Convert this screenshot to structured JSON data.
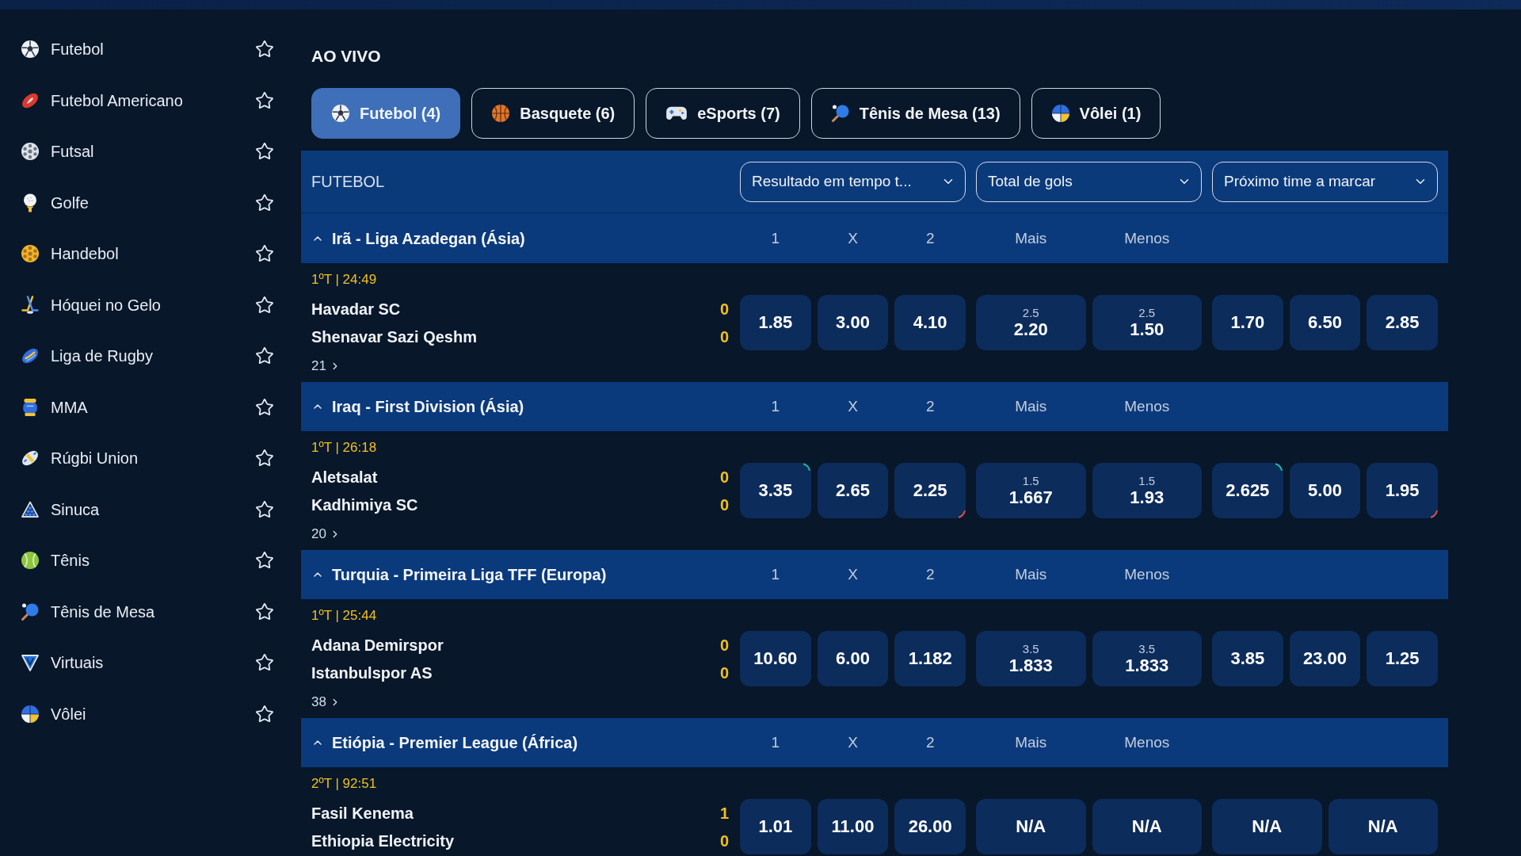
{
  "header": {
    "title": "AO VIVO"
  },
  "sidebar": {
    "items": [
      {
        "label": "Futebol",
        "favorite": false
      },
      {
        "label": "Futebol Americano",
        "favorite": false
      },
      {
        "label": "Futsal",
        "favorite": false
      },
      {
        "label": "Golfe",
        "favorite": false
      },
      {
        "label": "Handebol",
        "favorite": false
      },
      {
        "label": "Hóquei no Gelo",
        "favorite": false
      },
      {
        "label": "Liga de Rugby",
        "favorite": false
      },
      {
        "label": "MMA",
        "favorite": false
      },
      {
        "label": "Rúgbi Union",
        "favorite": false
      },
      {
        "label": "Sinuca",
        "favorite": false
      },
      {
        "label": "Tênis",
        "favorite": false
      },
      {
        "label": "Tênis de Mesa",
        "favorite": false
      },
      {
        "label": "Virtuais",
        "favorite": false
      },
      {
        "label": "Vôlei",
        "favorite": false
      }
    ]
  },
  "tabs": [
    {
      "label": "Futebol (4)",
      "selected": true
    },
    {
      "label": "Basquete (6)",
      "selected": false
    },
    {
      "label": "eSports (7)",
      "selected": false
    },
    {
      "label": "Tênis de Mesa (13)",
      "selected": false
    },
    {
      "label": "Vôlei (1)",
      "selected": false
    }
  ],
  "panel": {
    "sport": "FUTEBOL",
    "dropdowns": [
      "Resultado em tempo t...",
      "Total de gols",
      "Próximo time a marcar"
    ]
  },
  "leagues": [
    {
      "name": "Irã - Liga Azadegan (Ásia)",
      "expanded": true,
      "columns": [
        [
          "1",
          "X",
          "2"
        ],
        [
          "Mais",
          "Menos"
        ]
      ],
      "matches": [
        {
          "time": "1ºT | 24:49",
          "teams": [
            {
              "name": "Havadar SC",
              "score": "0"
            },
            {
              "name": "Shenavar Sazi Qeshm",
              "score": "0"
            }
          ],
          "more": "21",
          "odds": [
            [
              {
                "value": "1.85",
                "rising": false,
                "falling": false
              },
              {
                "value": "3.00",
                "rising": false,
                "falling": false
              },
              {
                "value": "4.10",
                "rising": false,
                "falling": false
              }
            ],
            [
              {
                "line": "2.5",
                "value": "2.20",
                "rising": false,
                "falling": false
              },
              {
                "line": "2.5",
                "value": "1.50",
                "rising": false,
                "falling": false
              }
            ],
            [
              {
                "value": "1.70",
                "rising": false,
                "falling": false
              },
              {
                "value": "6.50",
                "rising": false,
                "falling": false
              },
              {
                "value": "2.85",
                "rising": false,
                "falling": false
              }
            ]
          ]
        }
      ]
    },
    {
      "name": "Iraq - First Division (Ásia)",
      "expanded": true,
      "columns": [
        [
          "1",
          "X",
          "2"
        ],
        [
          "Mais",
          "Menos"
        ]
      ],
      "matches": [
        {
          "time": "1ºT | 26:18",
          "teams": [
            {
              "name": "Aletsalat",
              "score": "0"
            },
            {
              "name": "Kadhimiya SC",
              "score": "0"
            }
          ],
          "more": "20",
          "odds": [
            [
              {
                "value": "3.35",
                "rising": true,
                "falling": false
              },
              {
                "value": "2.65",
                "rising": false,
                "falling": false
              },
              {
                "value": "2.25",
                "rising": false,
                "falling": true
              }
            ],
            [
              {
                "line": "1.5",
                "value": "1.667",
                "rising": false,
                "falling": false
              },
              {
                "line": "1.5",
                "value": "1.93",
                "rising": false,
                "falling": false
              }
            ],
            [
              {
                "value": "2.625",
                "rising": true,
                "falling": false
              },
              {
                "value": "5.00",
                "rising": false,
                "falling": false
              },
              {
                "value": "1.95",
                "rising": false,
                "falling": true
              }
            ]
          ]
        }
      ]
    },
    {
      "name": "Turquia - Primeira Liga TFF (Europa)",
      "expanded": true,
      "columns": [
        [
          "1",
          "X",
          "2"
        ],
        [
          "Mais",
          "Menos"
        ]
      ],
      "matches": [
        {
          "time": "1ºT | 25:44",
          "teams": [
            {
              "name": "Adana Demirspor",
              "score": "0"
            },
            {
              "name": "Istanbulspor AS",
              "score": "0"
            }
          ],
          "more": "38",
          "odds": [
            [
              {
                "value": "10.60",
                "rising": false,
                "falling": false
              },
              {
                "value": "6.00",
                "rising": false,
                "falling": false
              },
              {
                "value": "1.182",
                "rising": false,
                "falling": false
              }
            ],
            [
              {
                "line": "3.5",
                "value": "1.833",
                "rising": false,
                "falling": false
              },
              {
                "line": "3.5",
                "value": "1.833",
                "rising": false,
                "falling": false
              }
            ],
            [
              {
                "value": "3.85",
                "rising": false,
                "falling": false
              },
              {
                "value": "23.00",
                "rising": false,
                "falling": false
              },
              {
                "value": "1.25",
                "rising": false,
                "falling": false
              }
            ]
          ]
        }
      ]
    },
    {
      "name": "Etiópia - Premier League (África)",
      "expanded": true,
      "columns": [
        [
          "1",
          "X",
          "2"
        ],
        [
          "Mais",
          "Menos"
        ]
      ],
      "matches": [
        {
          "time": "2ºT | 92:51",
          "teams": [
            {
              "name": "Fasil Kenema",
              "score": "1"
            },
            {
              "name": "Ethiopia Electricity",
              "score": "0"
            }
          ],
          "odds": [
            [
              {
                "value": "1.01",
                "rising": false,
                "falling": false
              },
              {
                "value": "11.00",
                "rising": false,
                "falling": false
              },
              {
                "value": "26.00",
                "rising": false,
                "falling": false
              }
            ],
            [
              {
                "value": "N/A",
                "rising": false,
                "falling": false
              },
              {
                "value": "N/A",
                "rising": false,
                "falling": false
              }
            ],
            [
              {
                "value": "N/A",
                "rising": false,
                "falling": false
              },
              {
                "value": "N/A",
                "rising": false,
                "falling": false
              }
            ]
          ]
        }
      ]
    }
  ]
}
